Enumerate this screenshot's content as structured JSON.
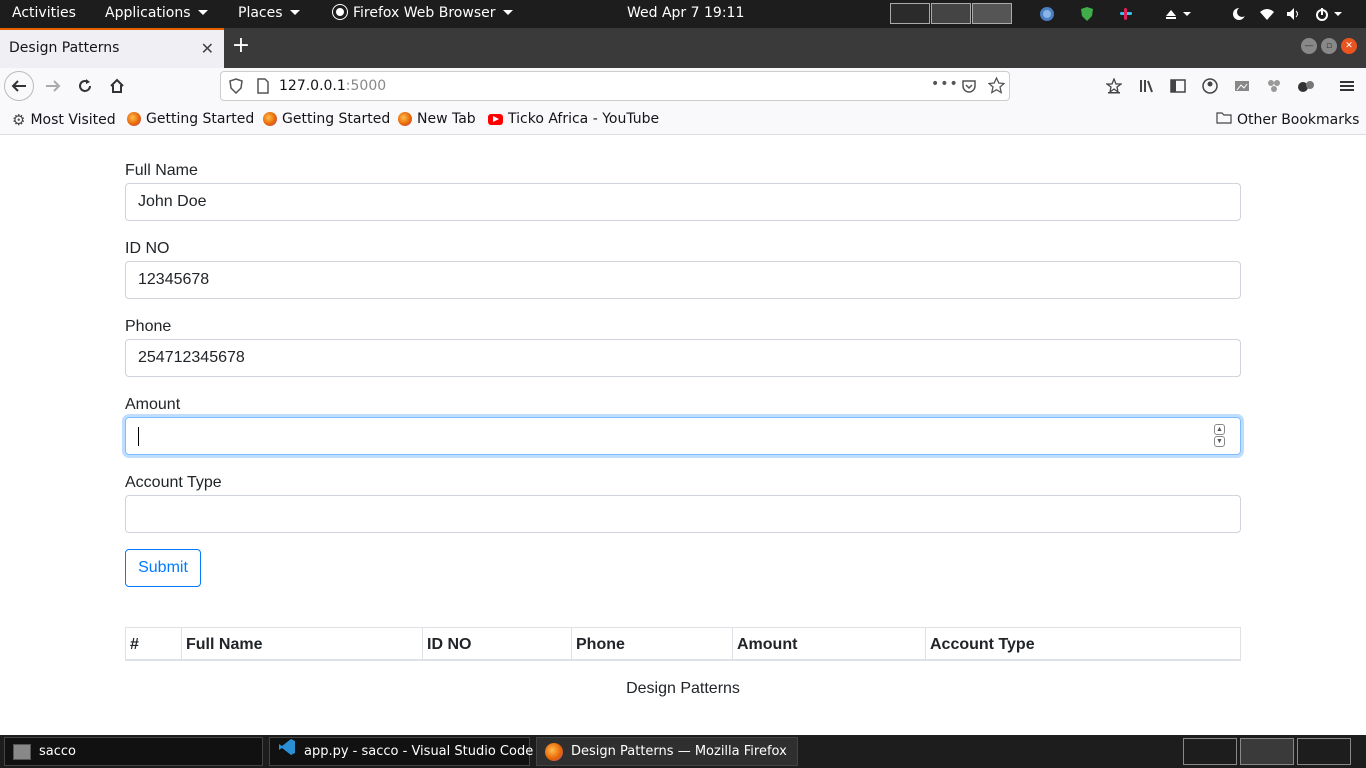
{
  "topbar": {
    "activities": "Activities",
    "applications": "Applications",
    "places": "Places",
    "app_name": "Firefox Web Browser",
    "clock": "Wed Apr 7  19:11"
  },
  "browser": {
    "tab_title": "Design Patterns",
    "url_host": "127.0.0.1",
    "url_port": ":5000"
  },
  "bookmarks": {
    "items": [
      {
        "label": "Most Visited"
      },
      {
        "label": "Getting Started"
      },
      {
        "label": "Getting Started"
      },
      {
        "label": "New Tab"
      },
      {
        "label": "Ticko Africa - YouTube"
      }
    ],
    "other": "Other Bookmarks"
  },
  "form": {
    "full_name": {
      "label": "Full Name",
      "value": "John Doe"
    },
    "id_no": {
      "label": "ID NO",
      "value": "12345678"
    },
    "phone": {
      "label": "Phone",
      "value": "254712345678"
    },
    "amount": {
      "label": "Amount",
      "value": ""
    },
    "account_type": {
      "label": "Account Type",
      "value": ""
    },
    "submit_label": "Submit"
  },
  "table": {
    "headers": [
      "#",
      "Full Name",
      "ID NO",
      "Phone",
      "Amount",
      "Account Type"
    ]
  },
  "footer": "Design Patterns",
  "taskbar": {
    "items": [
      {
        "label": "sacco"
      },
      {
        "label": "app.py - sacco - Visual Studio Code"
      },
      {
        "label": "Design Patterns — Mozilla Firefox"
      }
    ]
  },
  "colors": {
    "primary": "#007bff",
    "focus_border": "#80bdff",
    "tab_accent": "#e66000",
    "window_close": "#e95420"
  }
}
